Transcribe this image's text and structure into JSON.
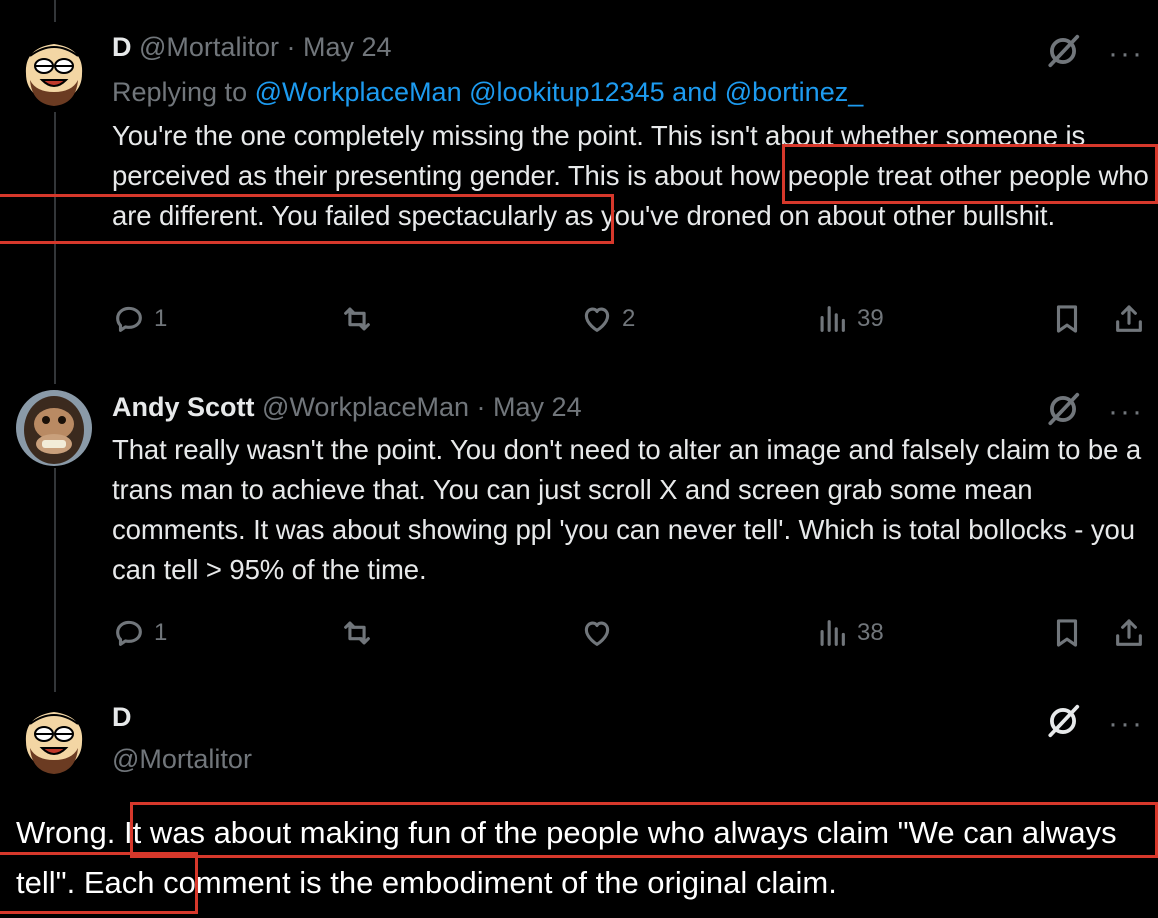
{
  "tweets": [
    {
      "display_name": "D",
      "handle": "@Mortalitor",
      "sep": "·",
      "date": "May 24",
      "replying_prefix": "Replying to",
      "replying_handles": "@WorkplaceMan @lookitup12345",
      "replying_and": "and",
      "replying_last": "@bortinez_",
      "text_a": "You're the one completely missing the point. This isn't about whether someone is perceived as their presenting gender. ",
      "text_highlight": "This is about how people treat other people who are different.",
      "text_b": " You failed spectacularly as you've droned on about other bullshit.",
      "replies": "1",
      "reposts": "",
      "likes": "2",
      "views": "39",
      "more": "···"
    },
    {
      "display_name": "Andy Scott",
      "handle": "@WorkplaceMan",
      "sep": "·",
      "date": "May 24",
      "text": "That really wasn't the point. You don't need to alter an image and falsely claim to be a trans man to achieve that. You can just scroll X and screen grab some mean comments. It was about showing ppl 'you can never tell'. Which is total bollocks - you can tell > 95% of the time.",
      "replies": "1",
      "reposts": "",
      "likes": "",
      "views": "38",
      "more": "···"
    },
    {
      "display_name": "D",
      "handle": "@Mortalitor",
      "text_a": "Wrong. ",
      "text_highlight": "It was about making fun of the people who always claim \"We can always tell\".",
      "text_b": " Each comment is the embodiment of the original claim.",
      "more": "···"
    }
  ],
  "icons": {
    "reply": "reply-icon",
    "repost": "repost-icon",
    "like": "heart-icon",
    "views": "views-icon",
    "bookmark": "bookmark-icon",
    "share": "share-icon",
    "grok": "grok-icon",
    "more": "more-icon"
  },
  "colors": {
    "background": "#000000",
    "text": "#e7e9ea",
    "muted": "#71767b",
    "link": "#1d9bf0",
    "highlight_box": "#d6382b"
  }
}
